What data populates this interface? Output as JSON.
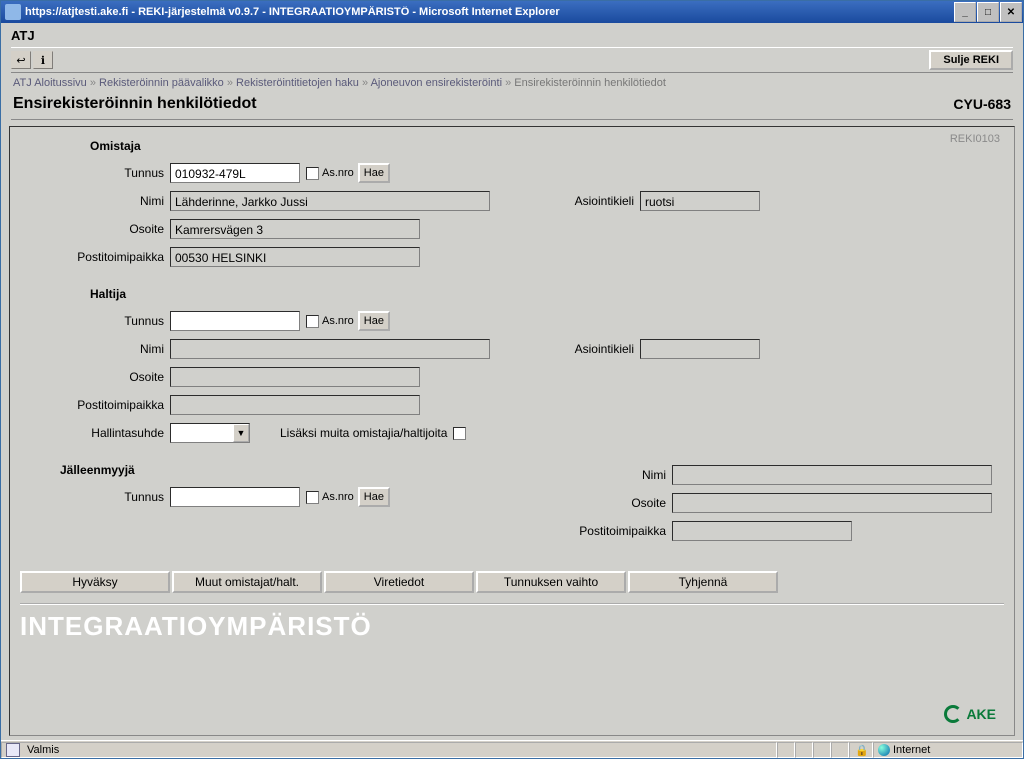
{
  "window": {
    "title": "https://atjtesti.ake.fi - REKI-järjestelmä v0.9.7 - INTEGRAATIOYMPÄRISTÖ - Microsoft Internet Explorer"
  },
  "app": {
    "name": "ATJ"
  },
  "toolbar": {
    "close_label": "Sulje REKI"
  },
  "breadcrumb": {
    "items": [
      "ATJ Aloitussivu",
      "Rekisteröinnin päävalikko",
      "Rekisteröintitietojen haku",
      "Ajoneuvon ensirekisteröinti",
      "Ensirekisteröinnin henkilötiedot"
    ],
    "sep": "»"
  },
  "page": {
    "title": "Ensirekisteröinnin henkilötiedot",
    "reg": "CYU-683",
    "screen_id": "REKI0103"
  },
  "labels": {
    "tunnus": "Tunnus",
    "nimi": "Nimi",
    "osoite": "Osoite",
    "postitoimipaikka": "Postitoimipaikka",
    "asiointikieli": "Asiointikieli",
    "hallintasuhde": "Hallintasuhde",
    "asnro": "As.nro",
    "hae": "Hae",
    "lisaksi": "Lisäksi muita omistajia/haltijoita"
  },
  "sections": {
    "omistaja": "Omistaja",
    "haltija": "Haltija",
    "jalleenmyyja": "Jälleenmyyjä"
  },
  "omistaja": {
    "tunnus": "010932-479L",
    "nimi": "Lähderinne, Jarkko Jussi",
    "osoite": "Kamrersvägen 3",
    "postitoimipaikka": "00530 HELSINKI",
    "asiointikieli": "ruotsi"
  },
  "haltija": {
    "tunnus": "",
    "nimi": "",
    "osoite": "",
    "postitoimipaikka": "",
    "asiointikieli": "",
    "hallintasuhde": ""
  },
  "jalleenmyyja": {
    "tunnus": "",
    "nimi": "",
    "osoite": "",
    "postitoimipaikka": ""
  },
  "buttons": {
    "hyvaksy": "Hyväksy",
    "muut": "Muut omistajat/halt.",
    "viretiedot": "Viretiedot",
    "tunnuksen": "Tunnuksen vaihto",
    "tyhjenna": "Tyhjennä"
  },
  "footer": {
    "env": "INTEGRAATIOYMPÄRISTÖ",
    "ake": "AKE"
  },
  "status": {
    "left": "Valmis",
    "zone": "Internet"
  }
}
